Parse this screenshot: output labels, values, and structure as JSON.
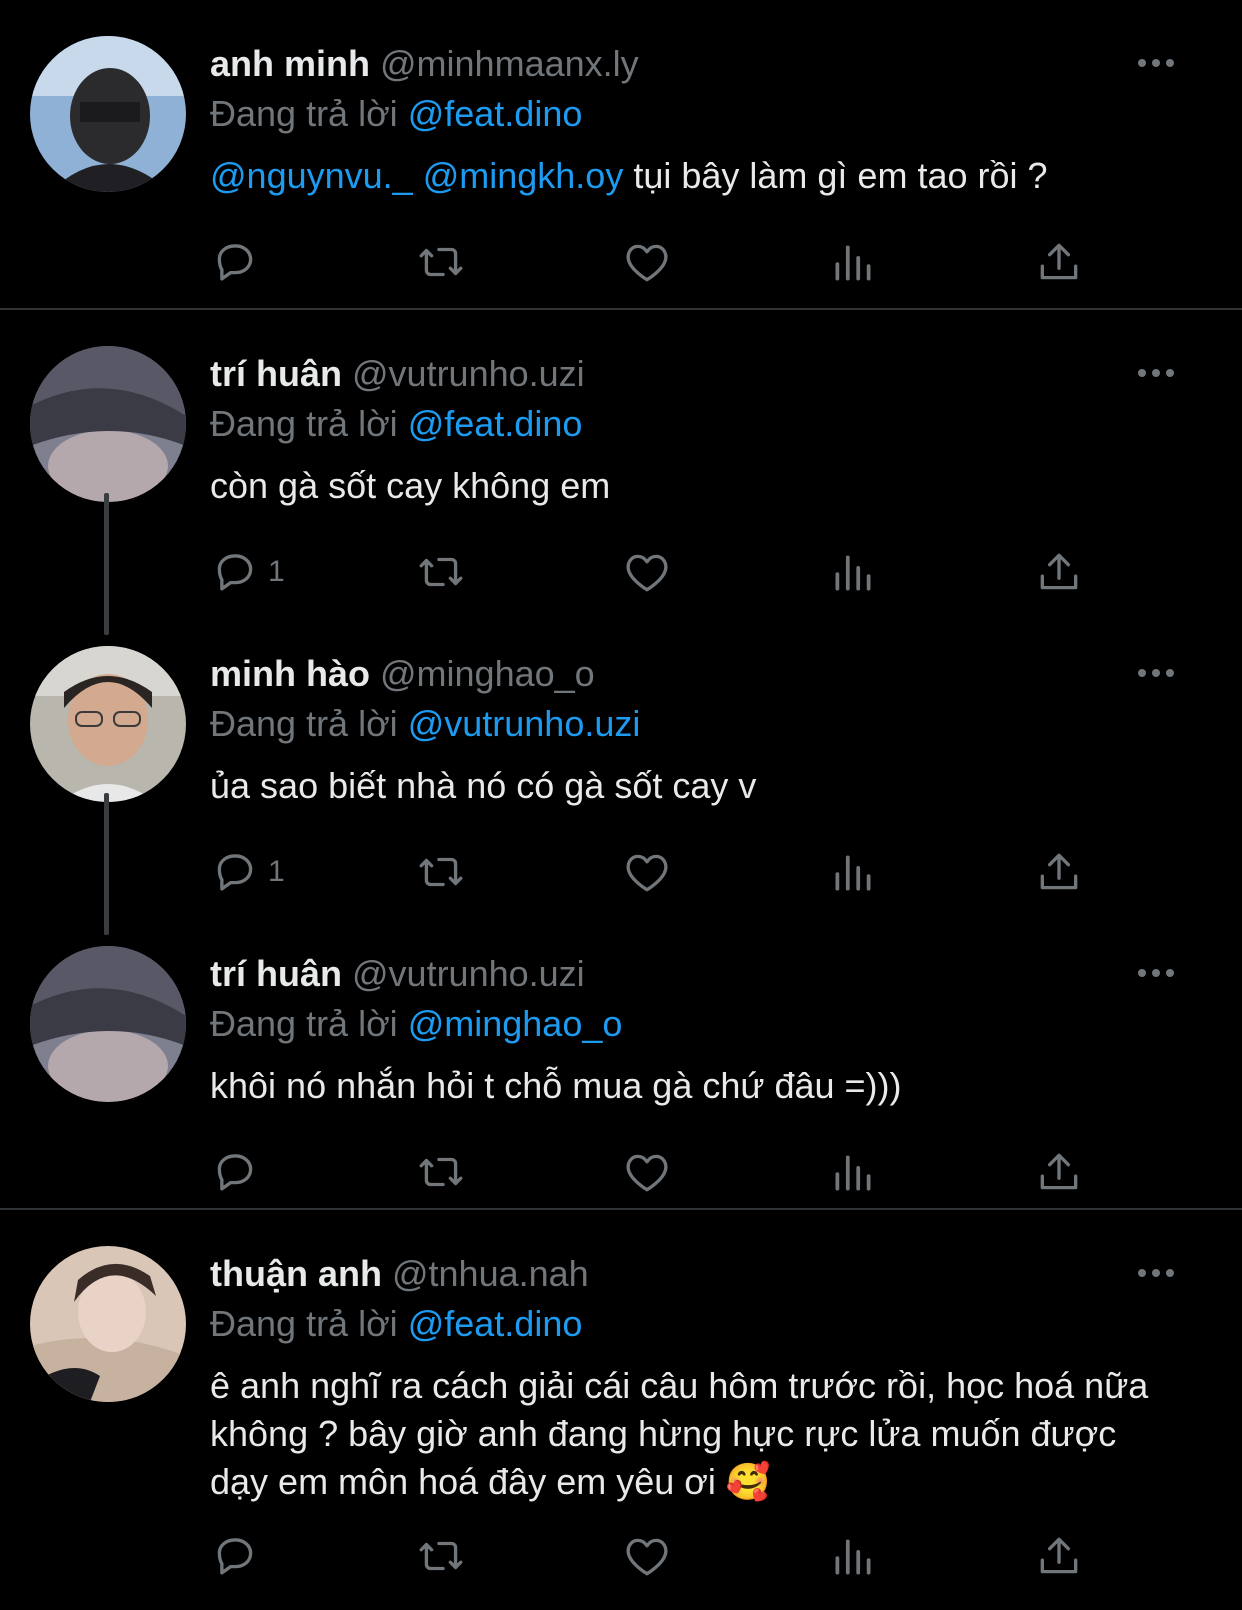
{
  "tweets": [
    {
      "name": "anh minh",
      "handle": "@minhmaanx.ly",
      "reply_prefix": "Đang trả lời",
      "reply_to": "@feat.dino",
      "mentions": [
        "@nguynvu._",
        "@mingkh.oy"
      ],
      "text": " tụi bây làm gì em tao rồi ?",
      "reply_count": ""
    },
    {
      "name": "trí huân",
      "handle": "@vutrunho.uzi",
      "reply_prefix": "Đang trả lời",
      "reply_to": "@feat.dino",
      "text": "còn gà sốt cay không em",
      "reply_count": "1"
    },
    {
      "name": "minh hào",
      "handle": "@minghao_o",
      "reply_prefix": "Đang trả lời",
      "reply_to": "@vutrunho.uzi",
      "text": "ủa sao biết nhà nó có gà sốt cay v",
      "reply_count": "1"
    },
    {
      "name": "trí huân",
      "handle": "@vutrunho.uzi",
      "reply_prefix": "Đang trả lời",
      "reply_to": "@minghao_o",
      "text": "khôi nó nhắn hỏi t chỗ mua gà chứ đâu =)))",
      "reply_count": ""
    },
    {
      "name": "thuận anh",
      "handle": "@tnhua.nah",
      "reply_prefix": "Đang trả lời",
      "reply_to": "@feat.dino",
      "text": "ê anh nghĩ ra cách giải cái câu hôm trước rồi, học hoá nữa không ? bây giờ anh đang hừng hực rực lửa muốn được dạy em môn hoá đây em yêu ơi 🥰",
      "reply_count": ""
    }
  ],
  "icons": {
    "reply": "reply-icon",
    "retweet": "retweet-icon",
    "like": "heart-icon",
    "views": "views-icon",
    "share": "share-icon",
    "more": "more-icon"
  },
  "colors": {
    "background": "#000000",
    "text": "#e7e9ea",
    "secondary": "#71767b",
    "link": "#1d9bf0",
    "divider": "#2f3336"
  }
}
